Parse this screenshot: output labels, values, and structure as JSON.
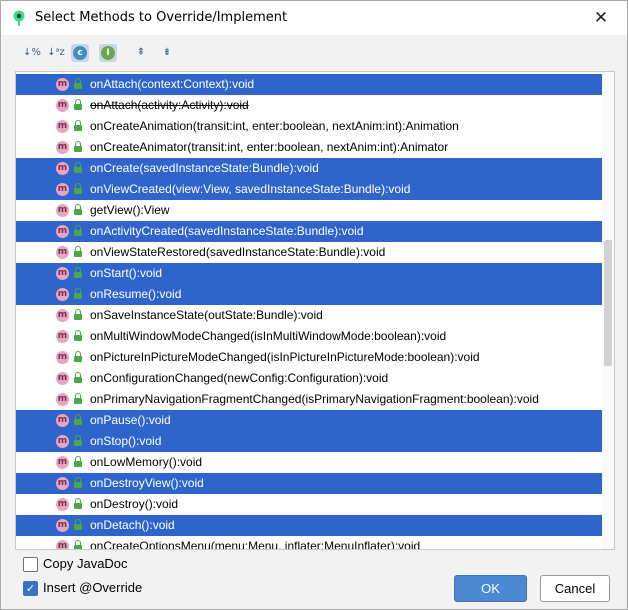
{
  "dialog": {
    "title": "Select Methods to Override/Implement",
    "close_glyph": "✕"
  },
  "toolbar": {
    "items": [
      {
        "name": "sort-by-percent-icon",
        "glyph": "↓%"
      },
      {
        "name": "sort-alphabetically-icon",
        "glyph": "↓ᵃz"
      },
      {
        "name": "show-classes-icon",
        "glyph": "c"
      },
      {
        "name": "show-interfaces-icon",
        "glyph": "I"
      },
      {
        "name": "expand-all-icon",
        "glyph": "⇞"
      },
      {
        "name": "collapse-all-icon",
        "glyph": "⇟"
      }
    ]
  },
  "methods": [
    {
      "sig": "onAttach(context:Context):void",
      "selected": true,
      "deprecated": false
    },
    {
      "sig": "onAttach(activity:Activity):void",
      "selected": false,
      "deprecated": true
    },
    {
      "sig": "onCreateAnimation(transit:int, enter:boolean, nextAnim:int):Animation",
      "selected": false,
      "deprecated": false
    },
    {
      "sig": "onCreateAnimator(transit:int, enter:boolean, nextAnim:int):Animator",
      "selected": false,
      "deprecated": false
    },
    {
      "sig": "onCreate(savedInstanceState:Bundle):void",
      "selected": true,
      "deprecated": false
    },
    {
      "sig": "onViewCreated(view:View, savedInstanceState:Bundle):void",
      "selected": true,
      "deprecated": false
    },
    {
      "sig": "getView():View",
      "selected": false,
      "deprecated": false
    },
    {
      "sig": "onActivityCreated(savedInstanceState:Bundle):void",
      "selected": true,
      "deprecated": false
    },
    {
      "sig": "onViewStateRestored(savedInstanceState:Bundle):void",
      "selected": false,
      "deprecated": false
    },
    {
      "sig": "onStart():void",
      "selected": true,
      "deprecated": false
    },
    {
      "sig": "onResume():void",
      "selected": true,
      "deprecated": false
    },
    {
      "sig": "onSaveInstanceState(outState:Bundle):void",
      "selected": false,
      "deprecated": false
    },
    {
      "sig": "onMultiWindowModeChanged(isInMultiWindowMode:boolean):void",
      "selected": false,
      "deprecated": false
    },
    {
      "sig": "onPictureInPictureModeChanged(isInPictureInPictureMode:boolean):void",
      "selected": false,
      "deprecated": false
    },
    {
      "sig": "onConfigurationChanged(newConfig:Configuration):void",
      "selected": false,
      "deprecated": false
    },
    {
      "sig": "onPrimaryNavigationFragmentChanged(isPrimaryNavigationFragment:boolean):void",
      "selected": false,
      "deprecated": false
    },
    {
      "sig": "onPause():void",
      "selected": true,
      "deprecated": false
    },
    {
      "sig": "onStop():void",
      "selected": true,
      "deprecated": false
    },
    {
      "sig": "onLowMemory():void",
      "selected": false,
      "deprecated": false
    },
    {
      "sig": "onDestroyView():void",
      "selected": true,
      "deprecated": false
    },
    {
      "sig": "onDestroy():void",
      "selected": false,
      "deprecated": false
    },
    {
      "sig": "onDetach():void",
      "selected": true,
      "deprecated": false
    },
    {
      "sig": "onCreateOptionsMenu(menu:Menu, inflater:MenuInflater):void",
      "selected": false,
      "deprecated": false
    }
  ],
  "method_icon_letter": "m",
  "options": {
    "copy_javadoc": {
      "label": "Copy JavaDoc",
      "checked": false
    },
    "insert_override": {
      "label": "Insert @Override",
      "checked": true
    }
  },
  "buttons": {
    "ok": "OK",
    "cancel": "Cancel"
  },
  "colors": {
    "selection": "#2f65ca",
    "ok_button": "#4b89d4",
    "method_icon": "#e6a6c0",
    "lock_icon": "#4aa84a"
  }
}
